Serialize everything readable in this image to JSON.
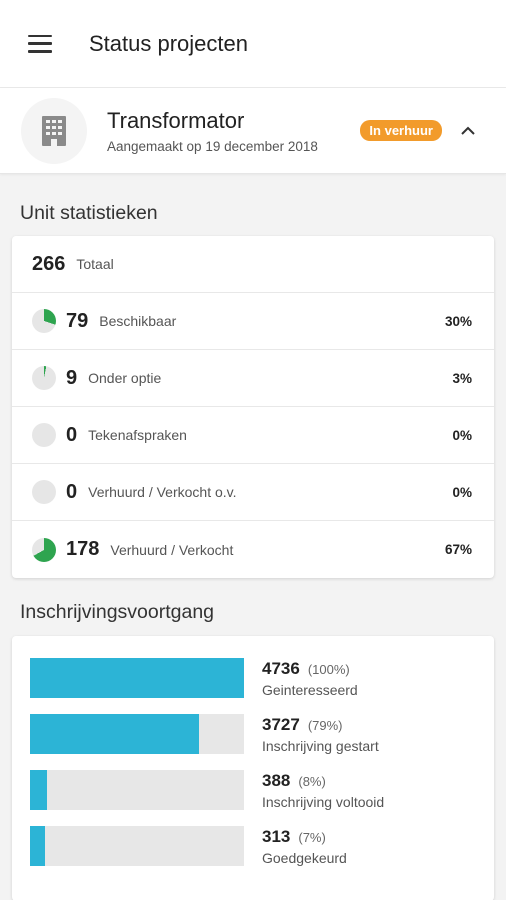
{
  "header": {
    "title": "Status projecten"
  },
  "project": {
    "name": "Transformator",
    "created": "Aangemaakt op 19 december 2018",
    "status_badge": "In verhuur"
  },
  "unit_stats": {
    "section_title": "Unit statistieken",
    "total": {
      "value": "266",
      "label": "Totaal"
    },
    "rows": [
      {
        "value": "79",
        "label": "Beschikbaar",
        "pct": "30%",
        "fraction": 0.3
      },
      {
        "value": "9",
        "label": "Onder optie",
        "pct": "3%",
        "fraction": 0.03
      },
      {
        "value": "0",
        "label": "Tekenafspraken",
        "pct": "0%",
        "fraction": 0
      },
      {
        "value": "0",
        "label": "Verhuurd / Verkocht o.v.",
        "pct": "0%",
        "fraction": 0
      },
      {
        "value": "178",
        "label": "Verhuurd / Verkocht",
        "pct": "67%",
        "fraction": 0.67
      }
    ]
  },
  "registration_progress": {
    "section_title": "Inschrijvingsvoortgang",
    "rows": [
      {
        "value": "4736",
        "pct": "(100%)",
        "label": "Geinteresseerd",
        "fraction": 1.0
      },
      {
        "value": "3727",
        "pct": "(79%)",
        "label": "Inschrijving gestart",
        "fraction": 0.79
      },
      {
        "value": "388",
        "pct": "(8%)",
        "label": "Inschrijving voltooid",
        "fraction": 0.08
      },
      {
        "value": "313",
        "pct": "(7%)",
        "label": "Goedgekeurd",
        "fraction": 0.07
      }
    ]
  },
  "colors": {
    "accent_bar": "#2cb4d6",
    "pie_fill": "#2ea44f",
    "badge": "#f29b2b"
  }
}
